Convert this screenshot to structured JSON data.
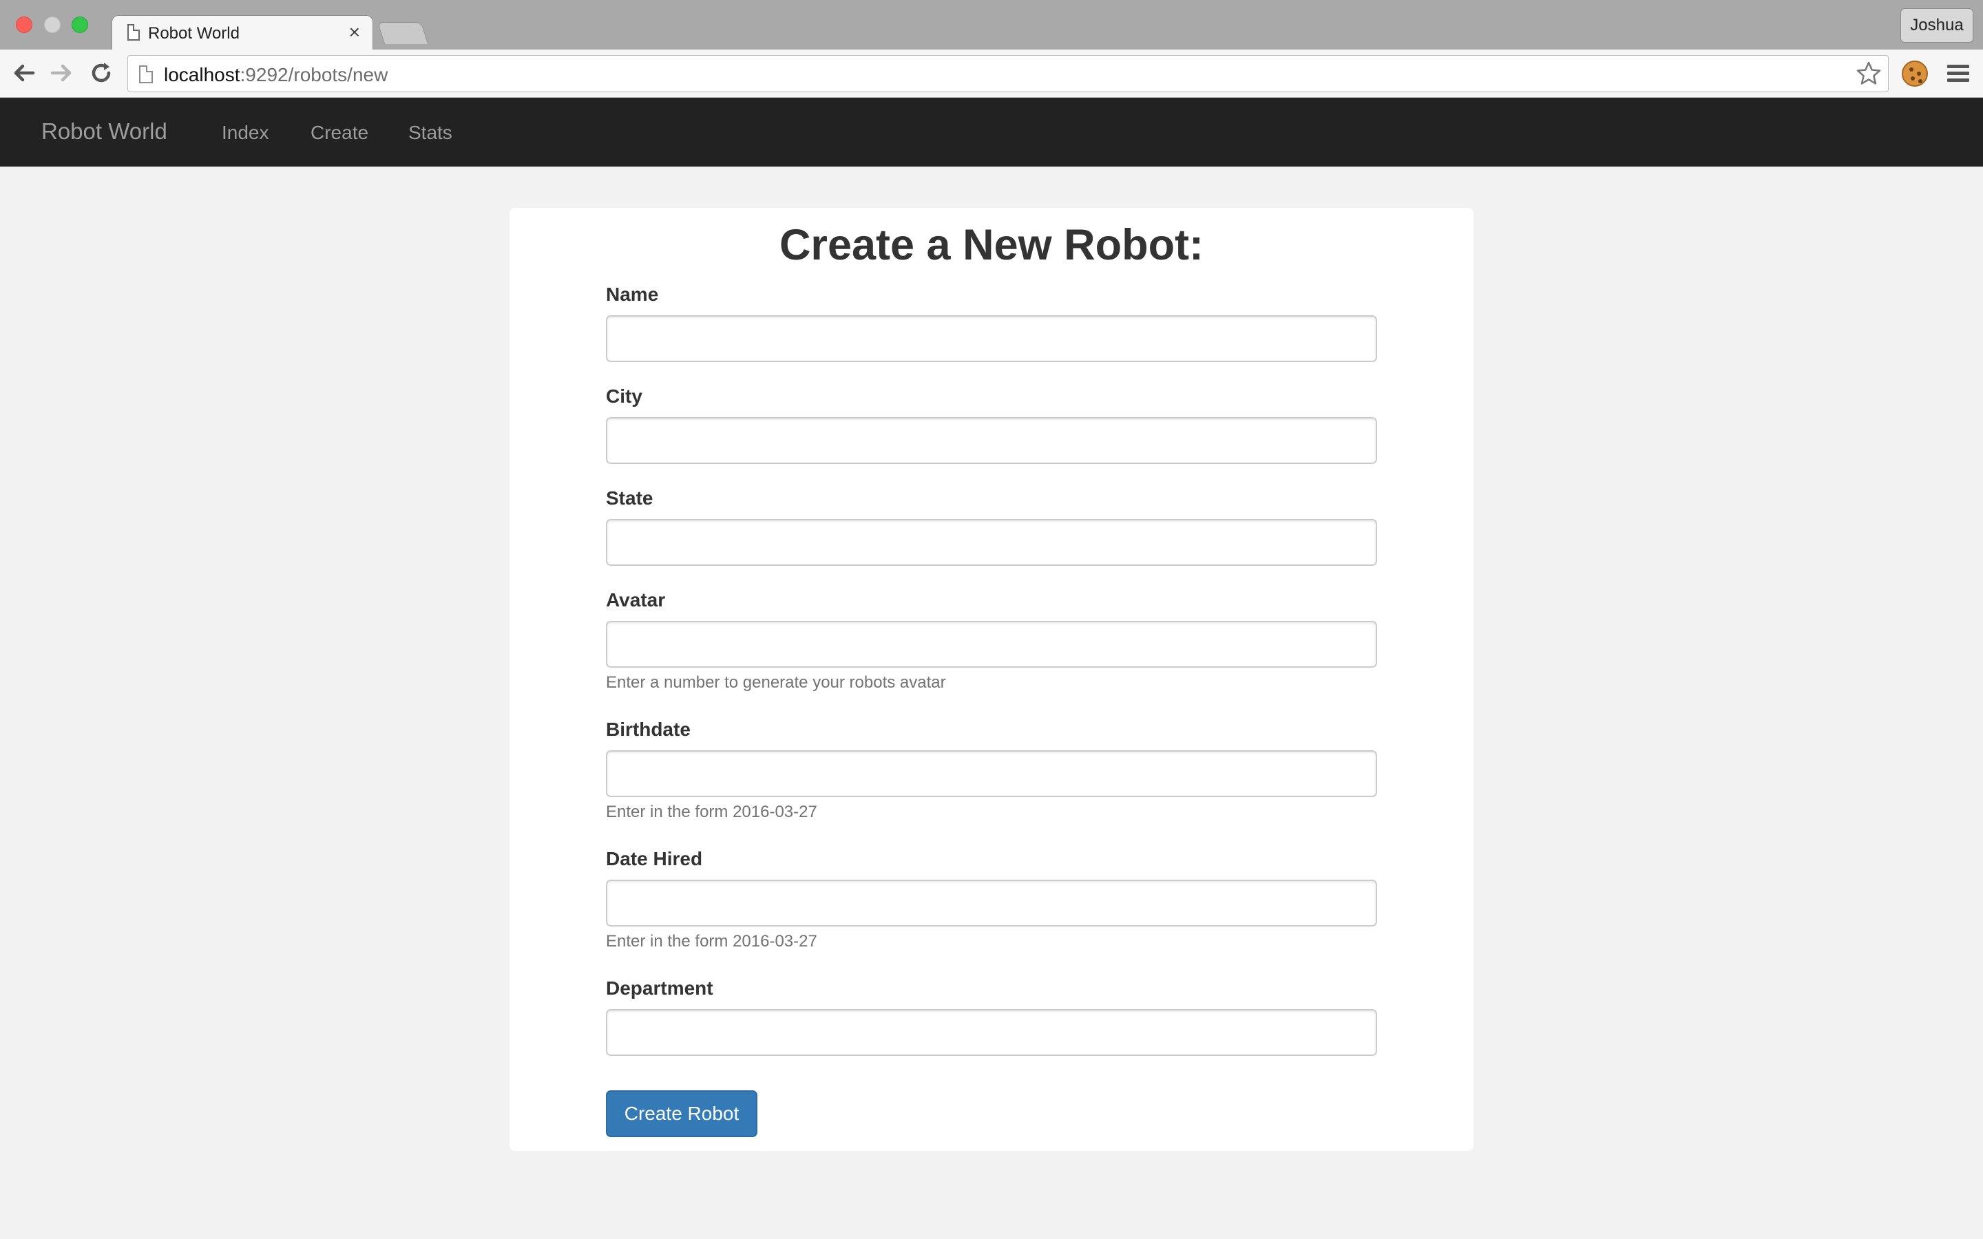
{
  "browser": {
    "tab_title": "Robot World",
    "tab_close_glyph": "×",
    "url_host": "localhost",
    "url_path": ":9292/robots/new",
    "profile_name": "Joshua"
  },
  "navbar": {
    "brand": "Robot World",
    "links": [
      "Index",
      "Create",
      "Stats"
    ]
  },
  "form": {
    "title": "Create a New Robot:",
    "fields": [
      {
        "label": "Name",
        "value": "",
        "help": ""
      },
      {
        "label": "City",
        "value": "",
        "help": ""
      },
      {
        "label": "State",
        "value": "",
        "help": ""
      },
      {
        "label": "Avatar",
        "value": "",
        "help": "Enter a number to generate your robots avatar"
      },
      {
        "label": "Birthdate",
        "value": "",
        "help": "Enter in the form 2016-03-27"
      },
      {
        "label": "Date Hired",
        "value": "",
        "help": "Enter in the form 2016-03-27"
      },
      {
        "label": "Department",
        "value": "",
        "help": ""
      }
    ],
    "submit_label": "Create Robot"
  },
  "colors": {
    "navbar_bg": "#222222",
    "primary_button": "#337ab7",
    "page_bg": "#f2f2f2"
  },
  "icons": [
    "page-icon",
    "close-icon",
    "back-arrow-icon",
    "forward-arrow-icon",
    "reload-icon",
    "bookmark-star-icon",
    "cookie-icon",
    "menu-icon"
  ]
}
